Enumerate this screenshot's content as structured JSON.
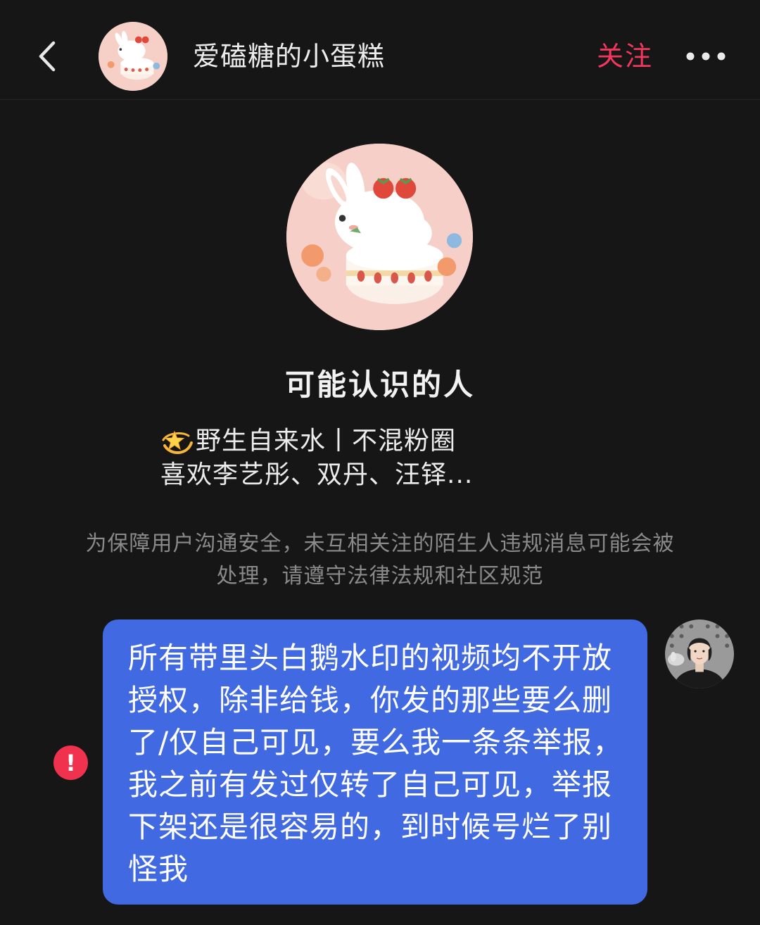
{
  "header": {
    "back_icon": "chevron-left-icon",
    "username": "爱磕糖的小蛋糕",
    "follow_label": "关注",
    "more_icon": "more-dots-icon"
  },
  "profile": {
    "title": "可能认识的人",
    "bio_emoji": "dizzy-star-icon",
    "bio_line1": "野生自来水丨不混粉圈",
    "bio_line2": "喜欢李艺彤、双丹、汪铎..."
  },
  "notice": {
    "text": "为保障用户沟通安全，未互相关注的陌生人违规消息可能会被处理，请遵守法律法规和社区规范"
  },
  "message": {
    "text": "所有带里头白鹅水印的视频均不开放授权，除非给钱，你发的那些要么删了/仅自己可见，要么我一条条举报，我之前有发过仅转了自己可见，举报下架还是很容易的，到时候号烂了别怪我",
    "status_icon": "send-failed-icon",
    "bubble_color": "#4169e1"
  },
  "colors": {
    "background": "#161616",
    "follow": "#f2365e",
    "error": "#f0324f"
  }
}
